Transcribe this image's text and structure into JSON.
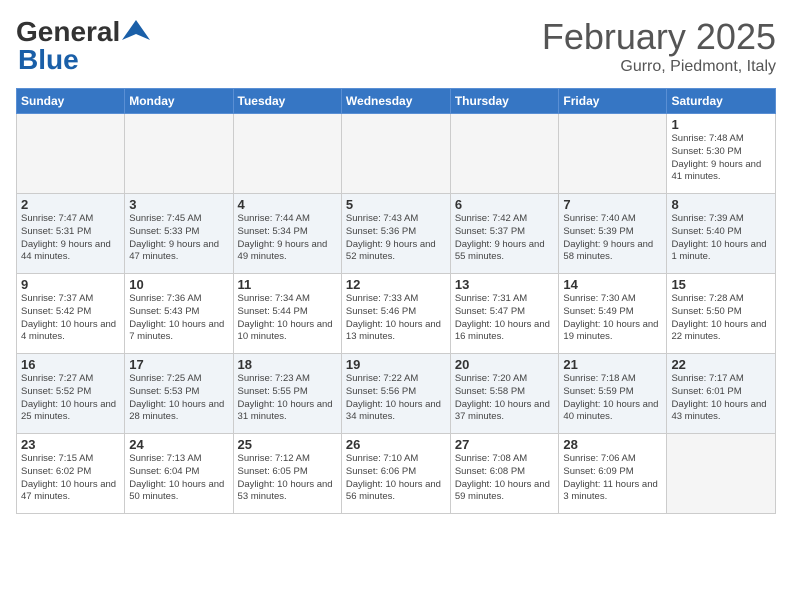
{
  "header": {
    "logo_general": "General",
    "logo_blue": "Blue",
    "title": "February 2025",
    "subtitle": "Gurro, Piedmont, Italy"
  },
  "weekdays": [
    "Sunday",
    "Monday",
    "Tuesday",
    "Wednesday",
    "Thursday",
    "Friday",
    "Saturday"
  ],
  "weeks": [
    [
      {
        "day": "",
        "info": ""
      },
      {
        "day": "",
        "info": ""
      },
      {
        "day": "",
        "info": ""
      },
      {
        "day": "",
        "info": ""
      },
      {
        "day": "",
        "info": ""
      },
      {
        "day": "",
        "info": ""
      },
      {
        "day": "1",
        "info": "Sunrise: 7:48 AM\nSunset: 5:30 PM\nDaylight: 9 hours and 41 minutes."
      }
    ],
    [
      {
        "day": "2",
        "info": "Sunrise: 7:47 AM\nSunset: 5:31 PM\nDaylight: 9 hours and 44 minutes."
      },
      {
        "day": "3",
        "info": "Sunrise: 7:45 AM\nSunset: 5:33 PM\nDaylight: 9 hours and 47 minutes."
      },
      {
        "day": "4",
        "info": "Sunrise: 7:44 AM\nSunset: 5:34 PM\nDaylight: 9 hours and 49 minutes."
      },
      {
        "day": "5",
        "info": "Sunrise: 7:43 AM\nSunset: 5:36 PM\nDaylight: 9 hours and 52 minutes."
      },
      {
        "day": "6",
        "info": "Sunrise: 7:42 AM\nSunset: 5:37 PM\nDaylight: 9 hours and 55 minutes."
      },
      {
        "day": "7",
        "info": "Sunrise: 7:40 AM\nSunset: 5:39 PM\nDaylight: 9 hours and 58 minutes."
      },
      {
        "day": "8",
        "info": "Sunrise: 7:39 AM\nSunset: 5:40 PM\nDaylight: 10 hours and 1 minute."
      }
    ],
    [
      {
        "day": "9",
        "info": "Sunrise: 7:37 AM\nSunset: 5:42 PM\nDaylight: 10 hours and 4 minutes."
      },
      {
        "day": "10",
        "info": "Sunrise: 7:36 AM\nSunset: 5:43 PM\nDaylight: 10 hours and 7 minutes."
      },
      {
        "day": "11",
        "info": "Sunrise: 7:34 AM\nSunset: 5:44 PM\nDaylight: 10 hours and 10 minutes."
      },
      {
        "day": "12",
        "info": "Sunrise: 7:33 AM\nSunset: 5:46 PM\nDaylight: 10 hours and 13 minutes."
      },
      {
        "day": "13",
        "info": "Sunrise: 7:31 AM\nSunset: 5:47 PM\nDaylight: 10 hours and 16 minutes."
      },
      {
        "day": "14",
        "info": "Sunrise: 7:30 AM\nSunset: 5:49 PM\nDaylight: 10 hours and 19 minutes."
      },
      {
        "day": "15",
        "info": "Sunrise: 7:28 AM\nSunset: 5:50 PM\nDaylight: 10 hours and 22 minutes."
      }
    ],
    [
      {
        "day": "16",
        "info": "Sunrise: 7:27 AM\nSunset: 5:52 PM\nDaylight: 10 hours and 25 minutes."
      },
      {
        "day": "17",
        "info": "Sunrise: 7:25 AM\nSunset: 5:53 PM\nDaylight: 10 hours and 28 minutes."
      },
      {
        "day": "18",
        "info": "Sunrise: 7:23 AM\nSunset: 5:55 PM\nDaylight: 10 hours and 31 minutes."
      },
      {
        "day": "19",
        "info": "Sunrise: 7:22 AM\nSunset: 5:56 PM\nDaylight: 10 hours and 34 minutes."
      },
      {
        "day": "20",
        "info": "Sunrise: 7:20 AM\nSunset: 5:58 PM\nDaylight: 10 hours and 37 minutes."
      },
      {
        "day": "21",
        "info": "Sunrise: 7:18 AM\nSunset: 5:59 PM\nDaylight: 10 hours and 40 minutes."
      },
      {
        "day": "22",
        "info": "Sunrise: 7:17 AM\nSunset: 6:01 PM\nDaylight: 10 hours and 43 minutes."
      }
    ],
    [
      {
        "day": "23",
        "info": "Sunrise: 7:15 AM\nSunset: 6:02 PM\nDaylight: 10 hours and 47 minutes."
      },
      {
        "day": "24",
        "info": "Sunrise: 7:13 AM\nSunset: 6:04 PM\nDaylight: 10 hours and 50 minutes."
      },
      {
        "day": "25",
        "info": "Sunrise: 7:12 AM\nSunset: 6:05 PM\nDaylight: 10 hours and 53 minutes."
      },
      {
        "day": "26",
        "info": "Sunrise: 7:10 AM\nSunset: 6:06 PM\nDaylight: 10 hours and 56 minutes."
      },
      {
        "day": "27",
        "info": "Sunrise: 7:08 AM\nSunset: 6:08 PM\nDaylight: 10 hours and 59 minutes."
      },
      {
        "day": "28",
        "info": "Sunrise: 7:06 AM\nSunset: 6:09 PM\nDaylight: 11 hours and 3 minutes."
      },
      {
        "day": "",
        "info": ""
      }
    ]
  ]
}
